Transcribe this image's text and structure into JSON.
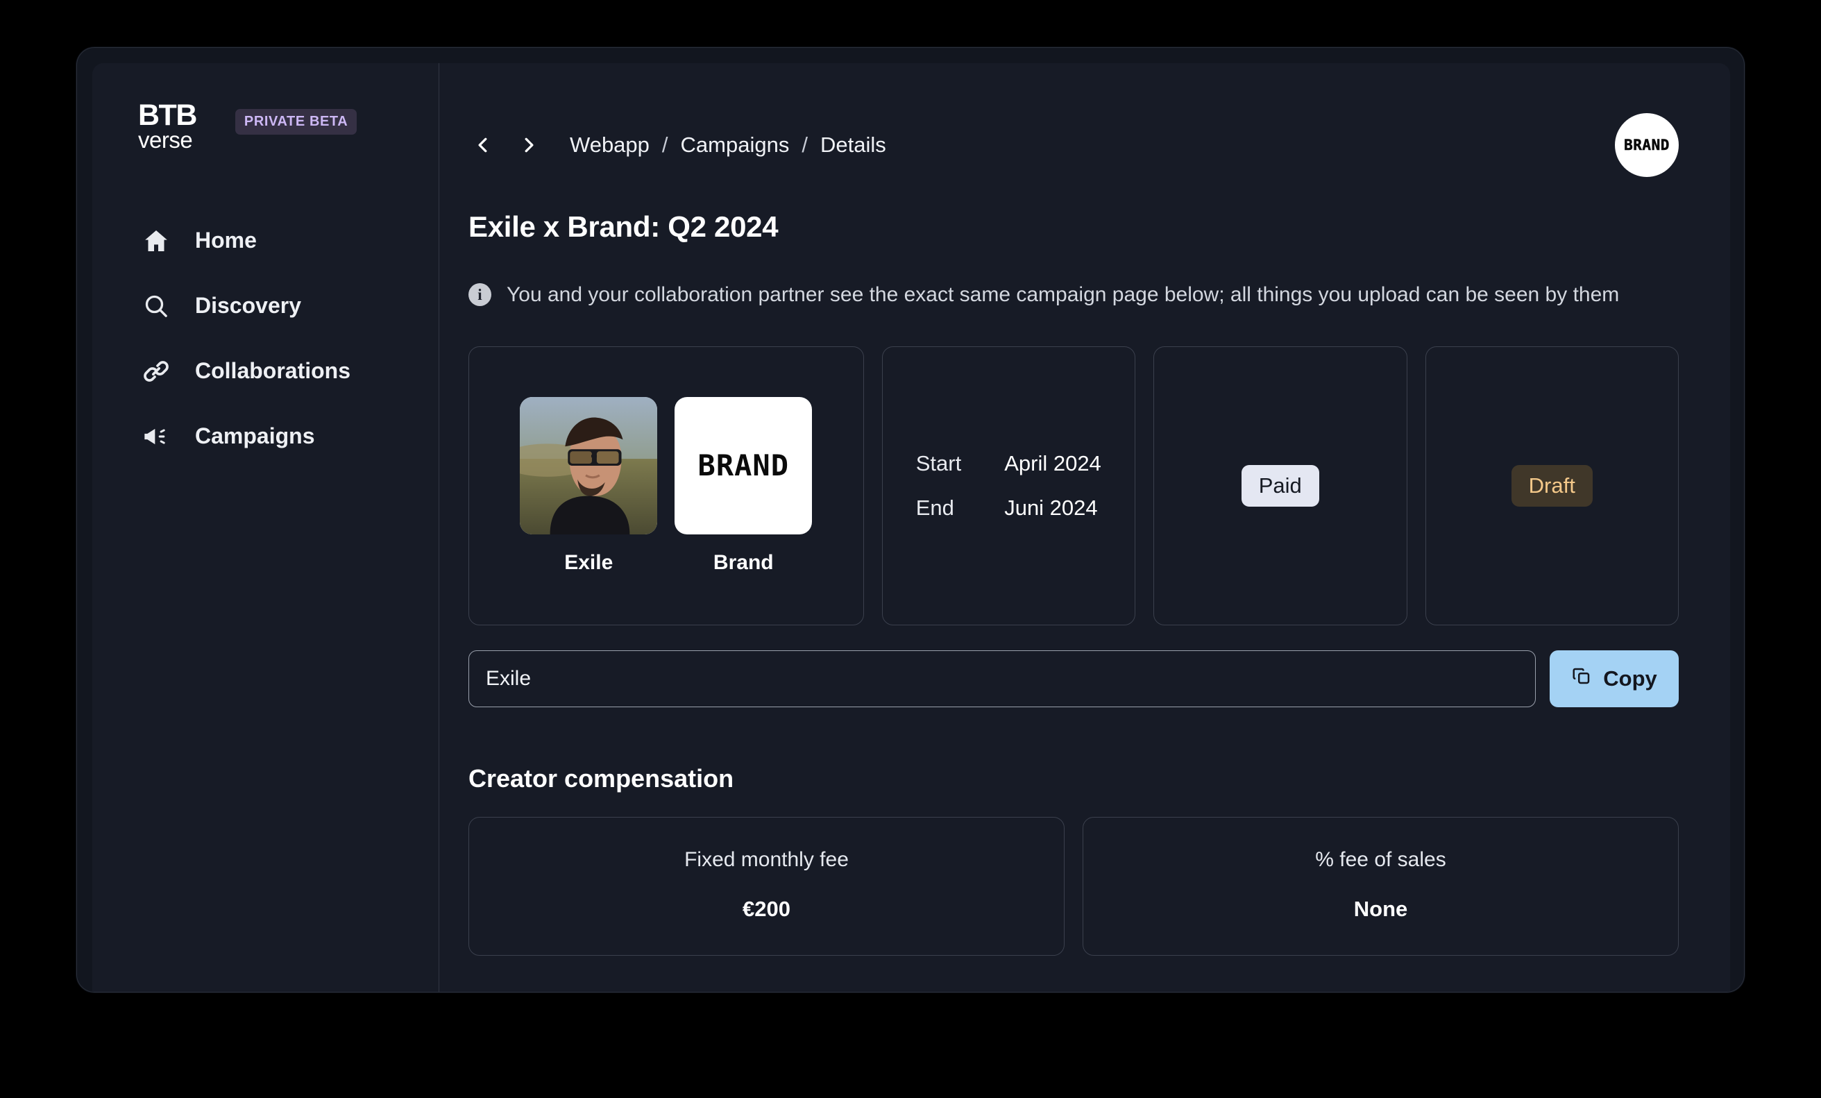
{
  "sidebar": {
    "logo": {
      "top": "BTB",
      "bottom": "verse"
    },
    "beta_badge": "PRIVATE BETA",
    "items": [
      {
        "label": "Home",
        "icon": "home-icon"
      },
      {
        "label": "Discovery",
        "icon": "search-icon"
      },
      {
        "label": "Collaborations",
        "icon": "link-icon"
      },
      {
        "label": "Campaigns",
        "icon": "megaphone-icon"
      }
    ]
  },
  "topbar": {
    "back": "‹",
    "forward": "›",
    "breadcrumb": [
      "Webapp",
      "Campaigns",
      "Details"
    ],
    "separator": "/",
    "avatar_text": "BRAND"
  },
  "page": {
    "title": "Exile x Brand: Q2 2024",
    "info_text": "You and your collaboration partner see the exact same campaign page below; all things you upload can be seen by them"
  },
  "partners": [
    {
      "name": "Exile",
      "image": "creator-portrait-photo"
    },
    {
      "name": "Brand",
      "image": "brand-logo",
      "logo_text": "BRAND"
    }
  ],
  "dates": {
    "start_label": "Start",
    "start_value": "April 2024",
    "end_label": "End",
    "end_value": "Juni 2024"
  },
  "status": {
    "payment": "Paid",
    "stage": "Draft"
  },
  "share": {
    "input_value": "Exile",
    "input_placeholder": "Exile",
    "copy_label": "Copy"
  },
  "compensation": {
    "section_title": "Creator compensation",
    "items": [
      {
        "label": "Fixed monthly fee",
        "value": "€200"
      },
      {
        "label": "% fee of sales",
        "value": "None"
      }
    ]
  },
  "colors": {
    "accent_copy": "#a4d2f4",
    "badge_beta_bg": "#353044",
    "badge_beta_text": "#cdb8f5",
    "pill_paid_bg": "#e4e7f2",
    "pill_draft_bg": "#403729",
    "pill_draft_text": "#f5c98a",
    "app_bg": "#171b26",
    "card_border": "#3b404d"
  }
}
